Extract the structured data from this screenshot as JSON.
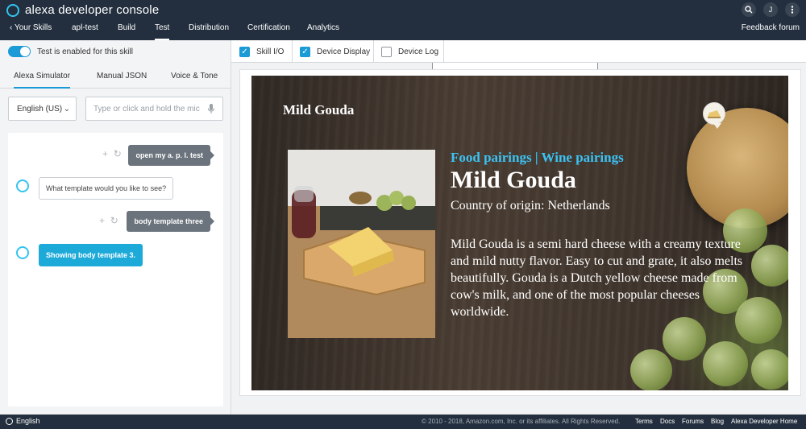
{
  "app": {
    "title": "alexa developer console",
    "nav": [
      {
        "label": "Your Skills"
      },
      {
        "label": "apl-test"
      },
      {
        "label": "Build"
      },
      {
        "label": "Test"
      },
      {
        "label": "Distribution"
      },
      {
        "label": "Certification"
      },
      {
        "label": "Analytics"
      }
    ],
    "feedback": "Feedback forum",
    "user_initial": "J"
  },
  "left": {
    "test_toggle_label": "Test is enabled for this skill",
    "tabs": [
      {
        "label": "Alexa Simulator"
      },
      {
        "label": "Manual JSON"
      },
      {
        "label": "Voice & Tone"
      }
    ],
    "language": "English (US)",
    "input_placeholder": "Type or click and hold the mic",
    "messages": [
      {
        "from": "user",
        "text": "open my a. p. l. test"
      },
      {
        "from": "alexa",
        "text": "What template would you like to see?"
      },
      {
        "from": "user",
        "text": "body template three"
      },
      {
        "from": "alexa",
        "text": "Showing body template 3."
      }
    ]
  },
  "right": {
    "checkboxes": [
      {
        "label": "Skill I/O",
        "checked": true
      },
      {
        "label": "Device Display",
        "checked": true
      },
      {
        "label": "Device Log",
        "checked": false
      }
    ],
    "screen": {
      "title": "Mild Gouda",
      "secondary": "Food pairings | Wine pairings",
      "primary": "Mild Gouda",
      "tertiary": "Country of origin: Netherlands",
      "body": "Mild Gouda is a semi hard cheese with a creamy texture and mild nutty flavor. Easy to cut and grate, it also melts beautifully. Gouda is a Dutch yellow cheese made from cow's milk, and one of the most popular cheeses worldwide."
    }
  },
  "footer": {
    "language": "English",
    "copyright": "© 2010 - 2018, Amazon.com, Inc. or its affiliates. All Rights Reserved.",
    "links": [
      {
        "label": "Terms"
      },
      {
        "label": "Docs"
      },
      {
        "label": "Forums"
      },
      {
        "label": "Blog"
      },
      {
        "label": "Alexa Developer Home"
      }
    ]
  },
  "colors": {
    "topbar": "#232f3e",
    "accent": "#1a9ad6",
    "alexa_ring": "#32c4f0",
    "secondary_text": "#3cc3f4"
  }
}
